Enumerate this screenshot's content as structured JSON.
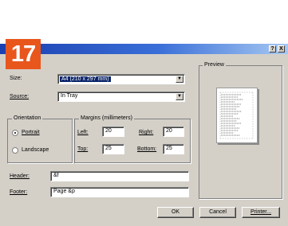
{
  "window": {
    "help_button": "?",
    "close_button": "X"
  },
  "badge": {
    "number": "17"
  },
  "size": {
    "label": "Size:",
    "value": "A4 (210 x 297 mm)"
  },
  "source": {
    "label": "Source:",
    "value": "In Tray"
  },
  "orientation": {
    "legend": "Orientation",
    "portrait_label": "Portrait",
    "landscape_label": "Landscape",
    "selected": "Portrait"
  },
  "margins": {
    "legend": "Margins (millimeters)",
    "left_label": "Left:",
    "left_value": "20",
    "right_label": "Right:",
    "right_value": "20",
    "top_label": "Top:",
    "top_value": "25",
    "bottom_label": "Bottom:",
    "bottom_value": "25"
  },
  "header": {
    "label": "Header:",
    "value": "&f"
  },
  "footer": {
    "label": "Footer:",
    "value": "Page &p"
  },
  "preview": {
    "legend": "Preview"
  },
  "buttons": {
    "ok": "OK",
    "cancel": "Cancel",
    "printer": "Printer..."
  },
  "colors": {
    "title_start": "#1a3fb0",
    "title_end": "#a6c8f2",
    "dialog_face": "#d4d0c8",
    "selection": "#0a246a",
    "badge": "#e8561c"
  }
}
